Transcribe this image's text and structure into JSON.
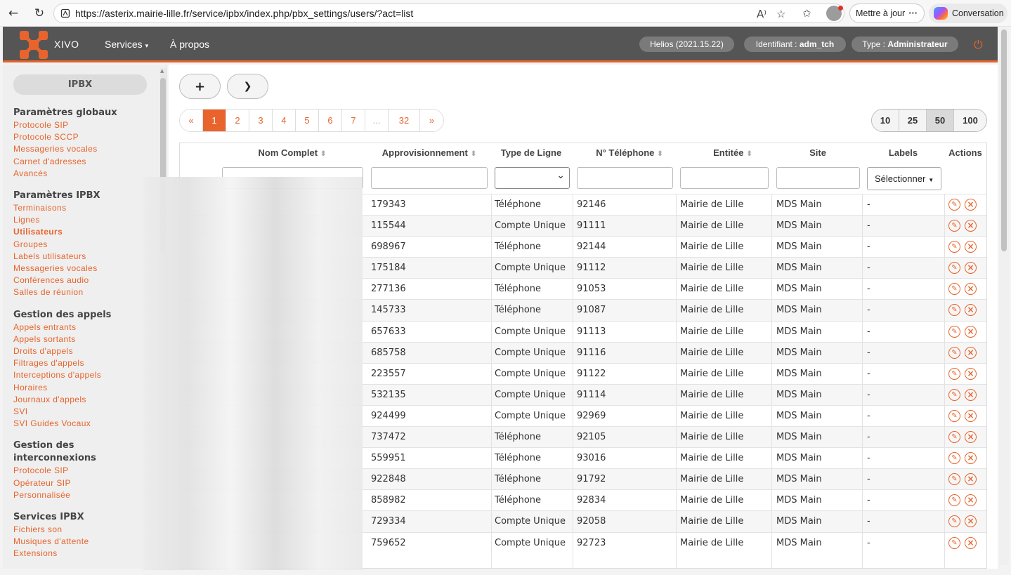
{
  "browser": {
    "url": "https://asterix.mairie-lille.fr/service/ipbx/index.php/pbx_settings/users/?act=list",
    "update_label": "Mettre à jour",
    "conversation_label": "Conversation"
  },
  "header": {
    "logo_text": "XIVO",
    "menu": [
      "Services",
      "À propos"
    ],
    "version": "Helios (2021.15.22)",
    "login_prefix": "Identifiant : ",
    "login_value": "adm_tch",
    "type_prefix": "Type : ",
    "type_value": "Administrateur"
  },
  "sidebar": {
    "title": "IPBX",
    "sections": [
      {
        "title": "Paramètres globaux",
        "links": [
          "Protocole SIP",
          "Protocole SCCP",
          "Messageries vocales",
          "Carnet d'adresses",
          "Avancés"
        ]
      },
      {
        "title": "Paramètres IPBX",
        "links": [
          "Terminaisons",
          "Lignes",
          "Utilisateurs",
          "Groupes",
          "Labels utilisateurs",
          "Messageries vocales",
          "Conférences audio",
          "Salles de réunion"
        ],
        "active": "Utilisateurs"
      },
      {
        "title": "Gestion des appels",
        "links": [
          "Appels entrants",
          "Appels sortants",
          "Droits d'appels",
          "Filtrages d'appels",
          "Interceptions d'appels",
          "Horaires",
          "Journaux d'appels",
          "SVI",
          "SVI Guides Vocaux"
        ]
      },
      {
        "title": "Gestion des interconnexions",
        "links": [
          "Protocole SIP",
          "Opérateur SIP",
          "Personnalisée"
        ]
      },
      {
        "title": "Services IPBX",
        "links": [
          "Fichiers son",
          "Musiques d'attente",
          "Extensions"
        ]
      }
    ]
  },
  "toolbar": {
    "add_label": "+",
    "dropdown_label": "⌄"
  },
  "pagination": {
    "pages": [
      "«",
      "1",
      "2",
      "3",
      "4",
      "5",
      "6",
      "7",
      "...",
      "32",
      "»"
    ],
    "current": "1",
    "per_page": [
      "10",
      "25",
      "50",
      "100"
    ],
    "per_page_selected": "50"
  },
  "table": {
    "headers": {
      "name": "Nom Complet",
      "provisioning": "Approvisionnement",
      "line_type": "Type de Ligne",
      "phone": "N° Téléphone",
      "entity": "Entitée",
      "site": "Site",
      "labels": "Labels",
      "actions": "Actions"
    },
    "labels_select": "Sélectionner",
    "rows": [
      [
        "179343",
        "Téléphone",
        "92146",
        "Mairie de Lille",
        "MDS Main",
        "-"
      ],
      [
        "115544",
        "Compte Unique",
        "91111",
        "Mairie de Lille",
        "MDS Main",
        "-"
      ],
      [
        "698967",
        "Téléphone",
        "92144",
        "Mairie de Lille",
        "MDS Main",
        "-"
      ],
      [
        "175184",
        "Compte Unique",
        "91112",
        "Mairie de Lille",
        "MDS Main",
        "-"
      ],
      [
        "277136",
        "Téléphone",
        "91053",
        "Mairie de Lille",
        "MDS Main",
        "-"
      ],
      [
        "145733",
        "Téléphone",
        "91087",
        "Mairie de Lille",
        "MDS Main",
        "-"
      ],
      [
        "657633",
        "Compte Unique",
        "91113",
        "Mairie de Lille",
        "MDS Main",
        "-"
      ],
      [
        "685758",
        "Compte Unique",
        "91116",
        "Mairie de Lille",
        "MDS Main",
        "-"
      ],
      [
        "223557",
        "Compte Unique",
        "91122",
        "Mairie de Lille",
        "MDS Main",
        "-"
      ],
      [
        "532135",
        "Compte Unique",
        "91114",
        "Mairie de Lille",
        "MDS Main",
        "-"
      ],
      [
        "924499",
        "Compte Unique",
        "92969",
        "Mairie de Lille",
        "MDS Main",
        "-"
      ],
      [
        "737472",
        "Téléphone",
        "92105",
        "Mairie de Lille",
        "MDS Main",
        "-"
      ],
      [
        "559951",
        "Téléphone",
        "93016",
        "Mairie de Lille",
        "MDS Main",
        "-"
      ],
      [
        "922848",
        "Téléphone",
        "91792",
        "Mairie de Lille",
        "MDS Main",
        "-"
      ],
      [
        "858982",
        "Téléphone",
        "92834",
        "Mairie de Lille",
        "MDS Main",
        "-"
      ],
      [
        "729334",
        "Compte Unique",
        "92058",
        "Mairie de Lille",
        "MDS Main",
        "-"
      ],
      [
        "759652",
        "Compte Unique",
        "92723",
        "Mairie de Lille",
        "MDS Main",
        "-"
      ]
    ]
  },
  "colors": {
    "accent": "#e8642c",
    "header_bg": "#555555"
  }
}
